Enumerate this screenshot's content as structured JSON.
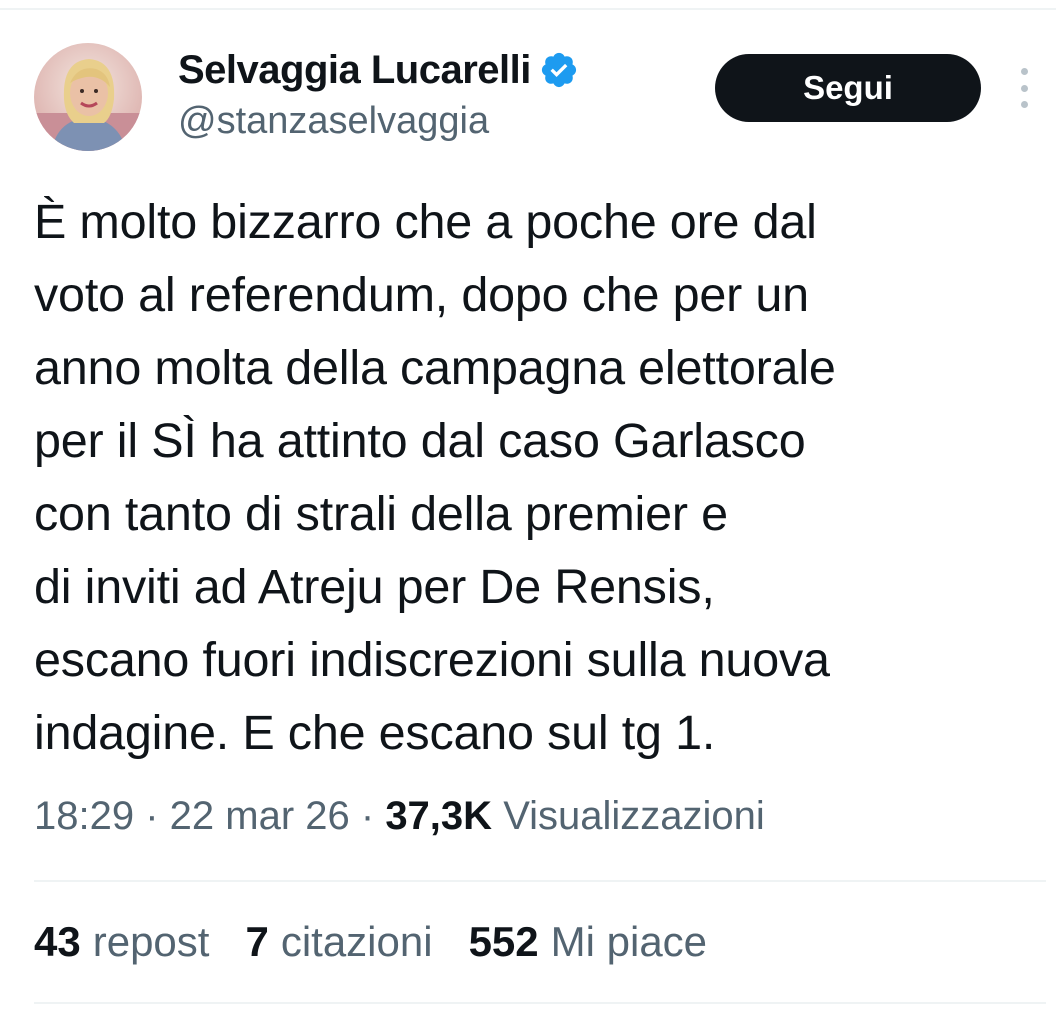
{
  "author": {
    "display_name": "Selvaggia Lucarelli",
    "handle": "@stanzaselvaggia",
    "verified": true
  },
  "actions": {
    "follow_label": "Segui"
  },
  "tweet": {
    "lines": [
      "È molto bizzarro che a poche ore dal",
      "voto al referendum, dopo che per un",
      "anno molta della campagna elettorale",
      "per il SÌ ha attinto dal caso Garlasco",
      "con tanto di strali della premier e",
      "di inviti ad Atreju per De Rensis,",
      "escano fuori indiscrezioni sulla nuova",
      "indagine. E che escano sul tg 1."
    ]
  },
  "meta": {
    "time": "18:29",
    "separator": " · ",
    "date": "22 mar 26",
    "views_count": "37,3K",
    "views_label": "Visualizzazioni"
  },
  "stats": {
    "reposts_count": "43",
    "reposts_label": "repost",
    "quotes_count": "7",
    "quotes_label": "citazioni",
    "likes_count": "552",
    "likes_label": "Mi piace"
  },
  "colors": {
    "text": "#0f1419",
    "secondary": "#536471",
    "verified_badge": "#1d9bf0",
    "follow_button_bg": "#0f1419",
    "divider": "#eff3f4"
  },
  "icons": [
    "verified-badge-icon",
    "more-options-icon"
  ]
}
